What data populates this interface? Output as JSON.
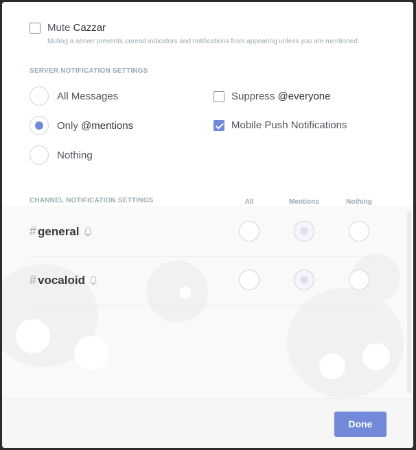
{
  "mute": {
    "label": "Mute",
    "server_name": "Cazzar",
    "checked": false,
    "description": "Muting a server prevents unread indicators and notifications from appearing unless you are mentioned."
  },
  "server_settings": {
    "title": "Server Notification Settings",
    "options": [
      {
        "label_prefix": "",
        "label": "All Messages",
        "selected": false
      },
      {
        "label_prefix": "Only ",
        "label": "@mentions",
        "selected": true
      },
      {
        "label_prefix": "",
        "label": "Nothing",
        "selected": false
      }
    ],
    "suppress_everyone": {
      "label_prefix": "Suppress ",
      "label": "@everyone",
      "checked": false
    },
    "mobile_push": {
      "label": "Mobile Push Notifications",
      "checked": true
    }
  },
  "channel_settings": {
    "title": "Channel Notification Settings",
    "columns": [
      "All",
      "Mentions",
      "Nothing"
    ],
    "channels": [
      {
        "hash": "#",
        "name": "general",
        "selected": "Mentions"
      },
      {
        "hash": "#",
        "name": "vocaloid",
        "selected": "Mentions"
      }
    ]
  },
  "footer": {
    "done_label": "Done"
  },
  "colors": {
    "accent": "#7289da"
  },
  "icons": {
    "bell": "bell-icon",
    "check": "check-icon"
  }
}
